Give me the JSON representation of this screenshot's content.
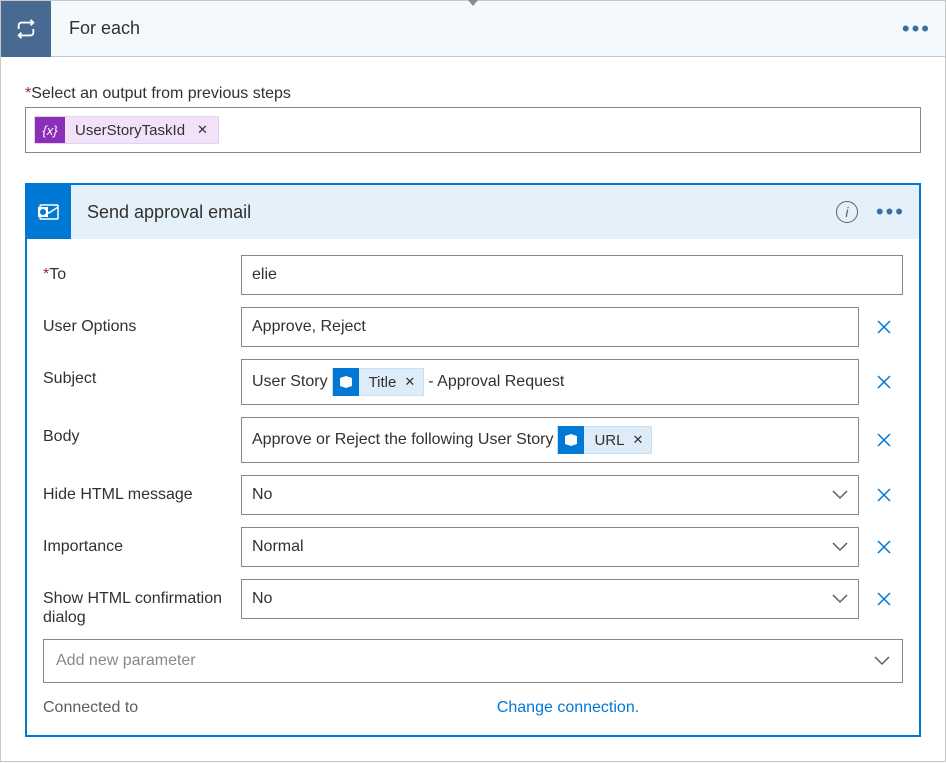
{
  "foreach": {
    "title": "For each",
    "output_label": "Select an output from previous steps",
    "token": {
      "icon_text": "{x}",
      "label": "UserStoryTaskId"
    }
  },
  "action": {
    "title": "Send approval email",
    "fields": {
      "to": {
        "label": "To",
        "value": "elie",
        "required": true
      },
      "userOptions": {
        "label": "User Options",
        "value": "Approve, Reject"
      },
      "subject": {
        "label": "Subject",
        "prefix": "User Story ",
        "chip": "Title",
        "suffix": " - Approval Request"
      },
      "body": {
        "label": "Body",
        "prefix": "Approve or Reject the following User Story ",
        "chip": "URL"
      },
      "hideHtml": {
        "label": "Hide HTML message",
        "value": "No"
      },
      "importance": {
        "label": "Importance",
        "value": "Normal"
      },
      "showHtmlConfirm": {
        "label": "Show HTML confirmation dialog",
        "value": "No"
      }
    },
    "addParam": "Add new parameter",
    "connection": {
      "label": "Connected to",
      "link": "Change connection."
    }
  }
}
